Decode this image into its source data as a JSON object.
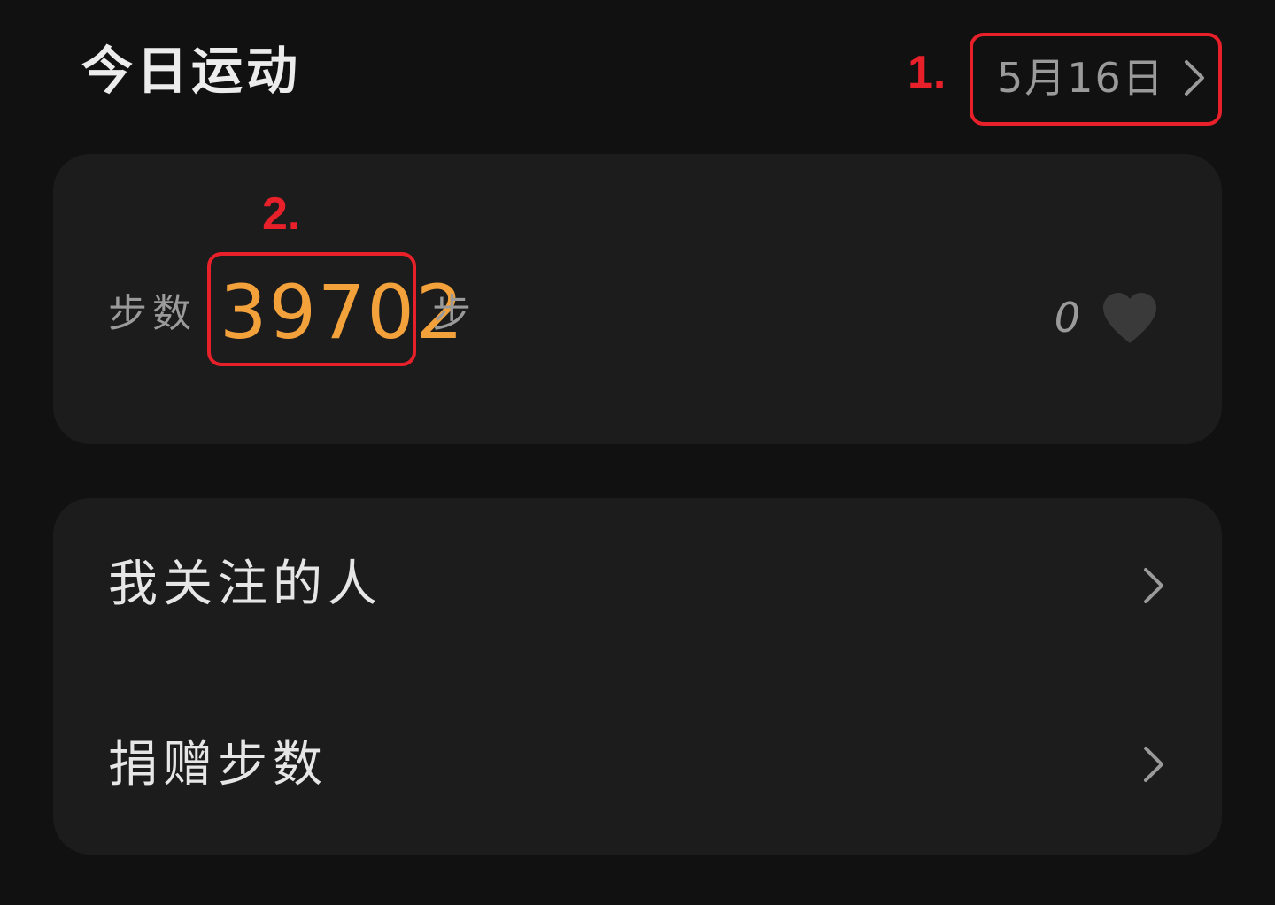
{
  "header": {
    "title": "今日运动",
    "date_label": "5月16日"
  },
  "annotations": {
    "marker_1": "1.",
    "marker_2": "2.",
    "highlight_color": "#e8202a"
  },
  "steps_card": {
    "label": "步数",
    "value": "39702",
    "unit": "步",
    "value_color": "#f3a13b",
    "likes_count": "0",
    "like_icon": "heart-icon"
  },
  "menu": {
    "items": [
      {
        "label": "我关注的人",
        "icon": "chevron-right-icon"
      },
      {
        "label": "捐赠步数",
        "icon": "chevron-right-icon"
      }
    ]
  },
  "colors": {
    "background": "#111111",
    "card": "#1c1c1c",
    "primary_text": "#e6e6e6",
    "secondary_text": "#9a9a9a"
  }
}
